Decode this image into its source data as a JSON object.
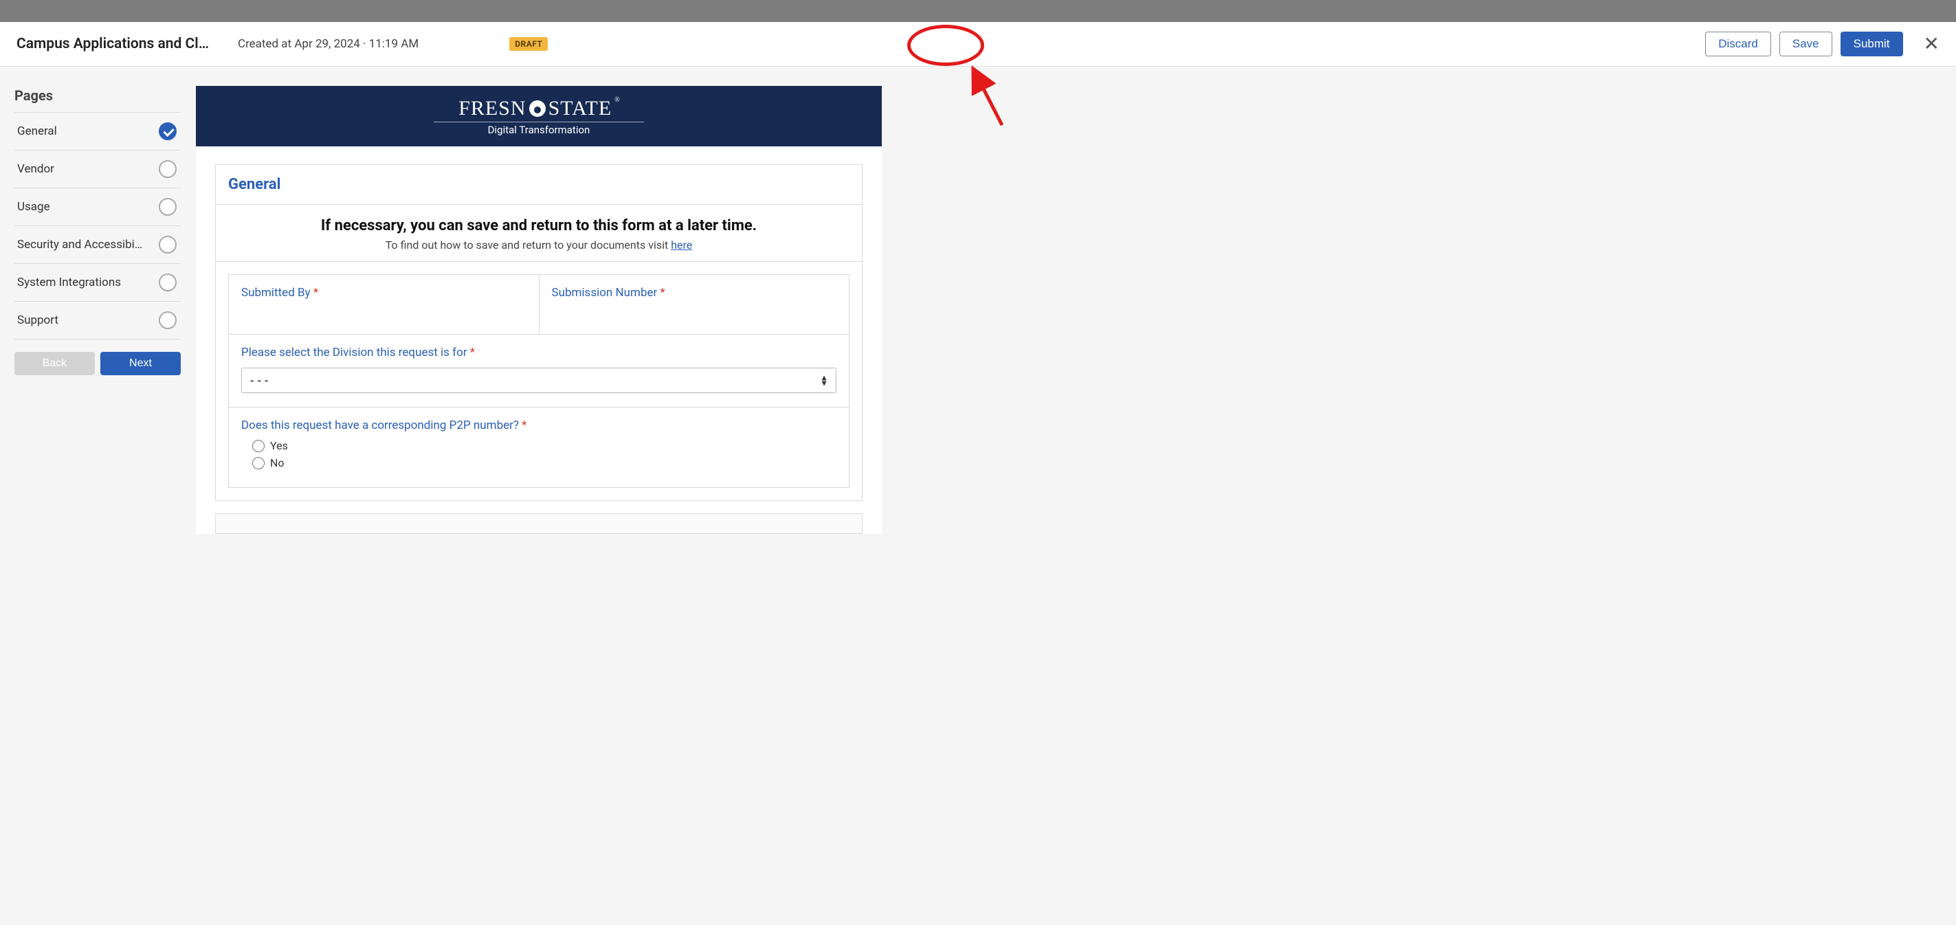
{
  "header": {
    "title": "Campus Applications and Classifi…",
    "created": "Created at Apr 29, 2024 · 11:19 AM",
    "draft_badge": "DRAFT",
    "discard_label": "Discard",
    "save_label": "Save",
    "submit_label": "Submit"
  },
  "sidebar": {
    "heading": "Pages",
    "items": [
      {
        "label": "General",
        "done": true
      },
      {
        "label": "Vendor",
        "done": false
      },
      {
        "label": "Usage",
        "done": false
      },
      {
        "label": "Security and Accessibi…",
        "done": false
      },
      {
        "label": "System Integrations",
        "done": false
      },
      {
        "label": "Support",
        "done": false
      }
    ],
    "back_label": "Back",
    "next_label": "Next"
  },
  "banner": {
    "logo_left": "FRESN",
    "logo_right": "STATE",
    "subtitle": "Digital Transformation"
  },
  "form": {
    "section_title": "General",
    "instr_main": "If necessary, you can save and return to this form at a later time.",
    "instr_sub_pre": "To find out how to save and return to your documents visit ",
    "instr_link": "here",
    "submitted_by_label": "Submitted By",
    "submitted_by_value": "",
    "submission_number_label": "Submission Number",
    "division_label": "Please select the Division this request is for",
    "division_placeholder": "- - -",
    "p2p_label": "Does this request have a corresponding P2P number?",
    "p2p_yes": "Yes",
    "p2p_no": "No",
    "required_mark": "*"
  }
}
